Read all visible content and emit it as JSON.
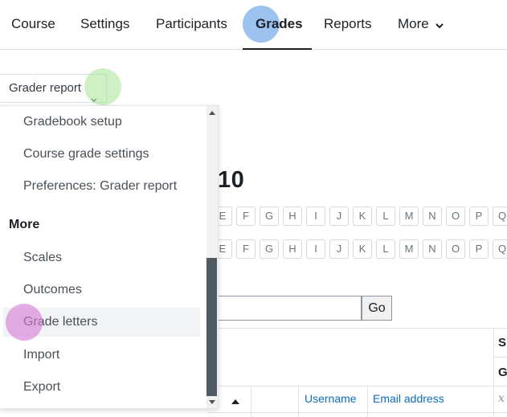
{
  "nav": {
    "tabs": [
      {
        "label": "Course"
      },
      {
        "label": "Settings"
      },
      {
        "label": "Participants"
      },
      {
        "label": "Grades",
        "active": true
      },
      {
        "label": "Reports"
      },
      {
        "label": "More"
      }
    ]
  },
  "report_selector": {
    "label": "Grader report"
  },
  "page": {
    "heading": "10",
    "letters_row": [
      "E",
      "F",
      "G",
      "H",
      "I",
      "J",
      "K",
      "L",
      "M",
      "N",
      "O",
      "P",
      "Q"
    ],
    "go_label": "Go"
  },
  "table": {
    "columns": [
      "Username",
      "Email address"
    ],
    "side_headers": [
      "S",
      "G"
    ]
  },
  "dropdown": {
    "items_top": [
      "Gradebook setup",
      "Course grade settings",
      "Preferences: Grader report"
    ],
    "section_header": "More",
    "items_more": [
      "Scales",
      "Outcomes",
      "Grade letters",
      "Import",
      "Export"
    ],
    "hovered": "Grade letters"
  },
  "colors": {
    "link": "#0f6cbf",
    "scroll_thumb": "#4f5a62",
    "highlight_blue": "#4a90e2",
    "highlight_green": "#a0e08c",
    "highlight_pink": "#d678d6"
  }
}
